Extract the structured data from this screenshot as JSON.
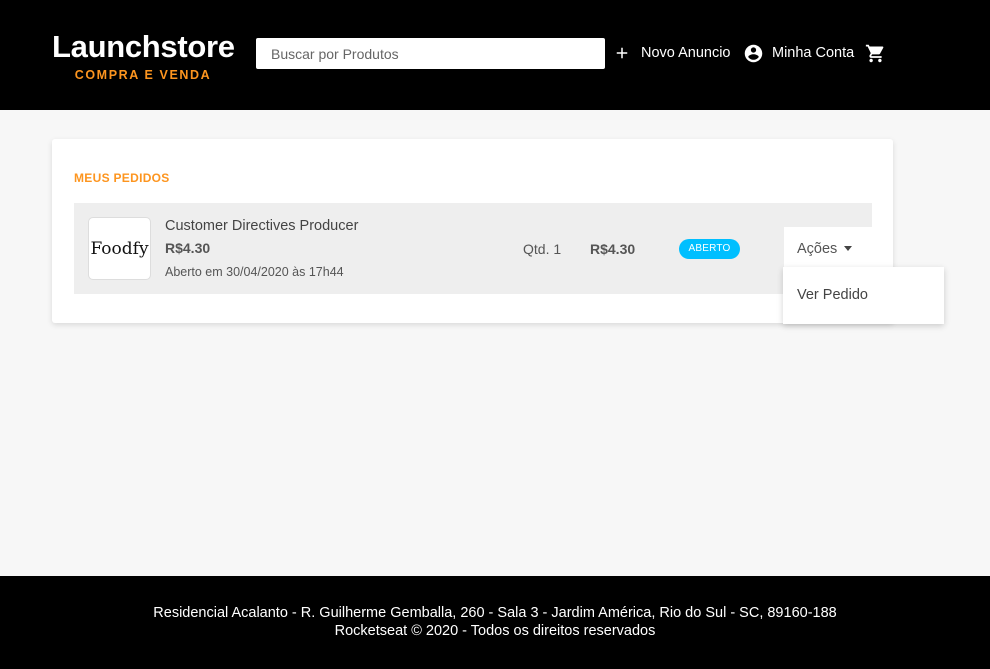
{
  "header": {
    "logo_title": "Launchstore",
    "logo_subtitle": "COMPRA E VENDA",
    "search_placeholder": "Buscar por Produtos",
    "new_ad_label": "Novo Anuncio",
    "account_label": "Minha Conta",
    "icons": {
      "new_ad": "plus-icon",
      "account": "account-circle-icon",
      "cart": "shopping-cart-icon"
    }
  },
  "orders": {
    "title": "MEUS PEDIDOS",
    "items": [
      {
        "image_text": "Foodfy",
        "name": "Customer Directives Producer",
        "price": "R$4.30",
        "opened_at": "Aberto em 30/04/2020 às 17h44",
        "quantity": "Qtd. 1",
        "total": "R$4.30",
        "status": "ABERTO",
        "actions_label": "Ações",
        "actions_menu": [
          "Ver Pedido"
        ]
      }
    ]
  },
  "footer": {
    "address": "Residencial Acalanto - R. Guilherme Gemballa, 260 - Sala 3 - Jardim América, Rio do Sul - SC, 89160-188",
    "copyright": "Rocketseat © 2020 - Todos os direitos reservados"
  },
  "colors": {
    "header_bg": "#000000",
    "accent": "#fd951f",
    "status_open": "#00bfff",
    "page_bg": "#f7f7f7"
  }
}
